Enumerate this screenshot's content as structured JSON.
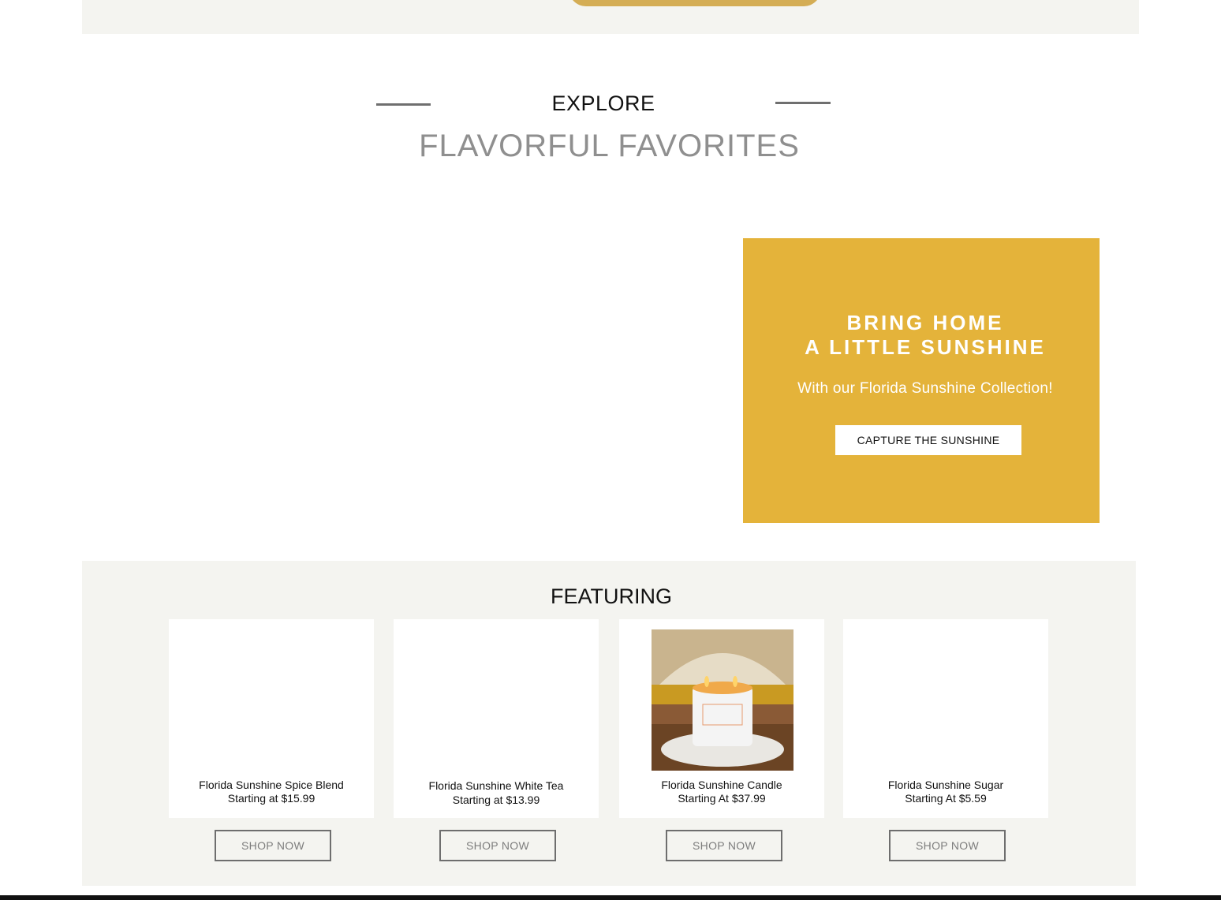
{
  "section": {
    "eyebrow": "EXPLORE",
    "title": "FLAVORFUL FAVORITES"
  },
  "promo": {
    "title_line1": "BRING HOME",
    "title_line2": "A LITTLE SUNSHINE",
    "subtitle": "With our Florida Sunshine Collection!",
    "button_label": "CAPTURE THE SUNSHINE",
    "bg_color": "#e4b33a"
  },
  "featuring": {
    "heading": "FEATURING",
    "products": [
      {
        "name": "Florida Sunshine Spice Blend",
        "price": "Starting at $15.99",
        "button": "SHOP NOW"
      },
      {
        "name": "Florida Sunshine White Tea",
        "price": "Starting at $13.99",
        "button": "SHOP NOW"
      },
      {
        "name": "Florida Sunshine Candle",
        "price": "Starting At $37.99",
        "button": "SHOP NOW"
      },
      {
        "name": "Florida Sunshine Sugar",
        "price": "Starting At $5.59",
        "button": "SHOP NOW"
      }
    ]
  },
  "colors": {
    "accent_gold": "#d4ad55",
    "band_bg": "#f4f4f0"
  }
}
